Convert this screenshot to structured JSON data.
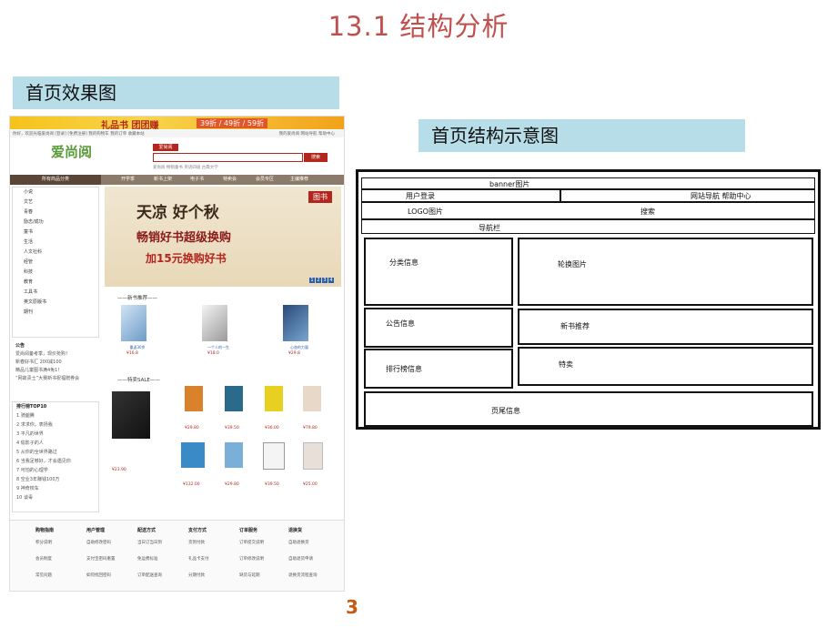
{
  "title": "13.1 结构分析",
  "label_left": "首页效果图",
  "label_right": "首页结构示意图",
  "page_number": "3",
  "screenshot": {
    "banner_text": "礼品书 团团赚",
    "banner_price": "39折 / 49折 / 59折",
    "topbar_left": "你好，欢迎光临爱尚阅 [登录] [免费注册] 我的购物车 我的订单 收藏本站",
    "topbar_right": "我的爱尚阅  网站导航  帮助中心",
    "logo": "爱尚阅",
    "search_tag": "爱尚阅",
    "search_button": "搜索",
    "hot_words": "爱尚阅 畅销童书 英语四级 古典文学",
    "nav_category": "所有商品分类",
    "nav_items": [
      "开学季",
      "新书上架",
      "电子书",
      "特卖会",
      "会员专区",
      "主编推荐"
    ],
    "categories": [
      "小说",
      "文艺",
      "青春",
      "励志/成功",
      "童书",
      "生活",
      "人文社科",
      "经管",
      "科技",
      "教育",
      "工具书",
      "英文原版书",
      "期刊"
    ],
    "carousel": {
      "line1": "天凉 好个秋",
      "line2": "畅销好书超级换购",
      "line3": "加15元换购好书",
      "tag": "图书",
      "dots": [
        "1",
        "2",
        "3",
        "4"
      ]
    },
    "new_books_title": "——新书推荐——",
    "new_books": [
      {
        "caption": "重返30岁",
        "price": "¥16.8"
      },
      {
        "caption": "一个人的一生",
        "price": "¥18.0"
      },
      {
        "caption": "心态的力量",
        "price": "¥29.8"
      }
    ],
    "sale_title": "——特卖SALE——",
    "sale_books": [
      {
        "price": "¥29.80"
      },
      {
        "price": "¥39.50"
      },
      {
        "price": "¥36.00"
      },
      {
        "price": "¥79.80"
      },
      {
        "price": "¥132.00"
      },
      {
        "price": "¥29.80"
      },
      {
        "price": "¥39.50"
      },
      {
        "price": "¥25.00"
      }
    ],
    "sale_main_price": "¥23.90",
    "notice": {
      "title": "公告",
      "items": [
        "爱尚阅备考季，现价抢购！",
        "新春好书汇 200减100",
        "精品儿童图书满4免1！",
        "“网故责士”大赛新书祝福赠券会"
      ]
    },
    "rank": {
      "title": "排行榜TOP10",
      "items": [
        "1 骑腿腾",
        "2 求求你，表扬我",
        "3 平凡的世界",
        "4 偷影子的人",
        "5 从你的全世界路过",
        "6 当我足够好，才会遇见你",
        "7 可怕的心理学",
        "8 空业3年赚钱100万",
        "9 神奇校车",
        "10 谈毒"
      ]
    },
    "footer": [
      {
        "title": "购物指南",
        "items": [
          "积分说明",
          "会员制度",
          "常见问题"
        ]
      },
      {
        "title": "用户管理",
        "items": [
          "自助修改密码",
          "支付宝密码重置",
          "如何找回密码"
        ]
      },
      {
        "title": "配送方式",
        "items": [
          "当日订当日到",
          "免运费标准",
          "订单配送查询"
        ]
      },
      {
        "title": "支付方式",
        "items": [
          "货到付款",
          "礼品卡支付",
          "分期付款"
        ]
      },
      {
        "title": "订单服务",
        "items": [
          "订单提交说明",
          "订单修改说明",
          "缺货与延期"
        ]
      },
      {
        "title": "退换货",
        "items": [
          "自助退换货",
          "自助退货申请",
          "退换货流程查询"
        ]
      }
    ]
  },
  "diagram": {
    "banner": "banner图片",
    "user_login": "用户登录",
    "site_nav": "网站导航  帮助中心",
    "logo": "LOGO图片",
    "search": "搜索",
    "navbar": "导航栏",
    "category": "分类信息",
    "carousel": "轮换图片",
    "notice": "公告信息",
    "new_books": "新书推荐",
    "ranking": "排行榜信息",
    "special_sale": "特卖",
    "footer": "页尾信息"
  }
}
